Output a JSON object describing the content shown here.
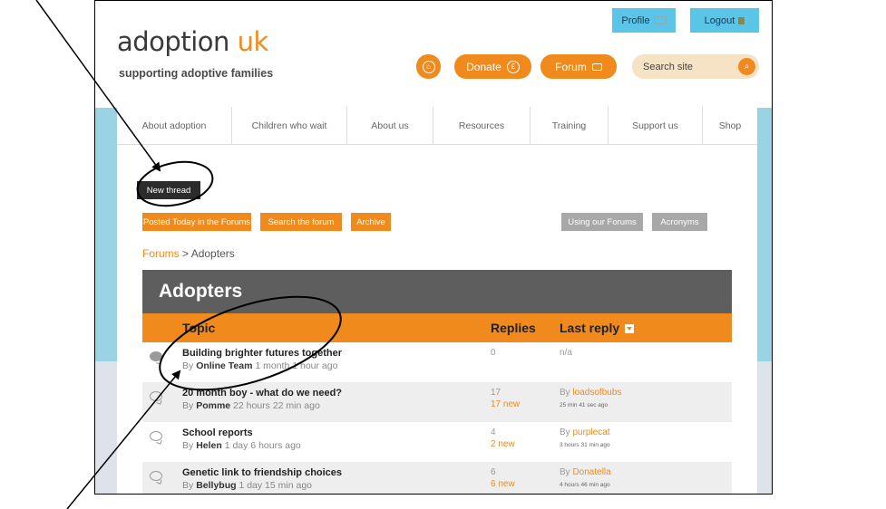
{
  "header": {
    "logo_main": "adoption ",
    "logo_accent": "uk",
    "tagline": "supporting adoptive families",
    "profile_label": "Profile",
    "logout_label": "Logout",
    "donate_label": "Donate",
    "forum_label": "Forum",
    "search_placeholder": "Search site"
  },
  "nav": [
    "About adoption",
    "Children who wait",
    "About us",
    "Resources",
    "Training",
    "Support us",
    "Shop"
  ],
  "toolbar": {
    "new_thread": "New thread",
    "posted_today": "Posted Today in the Forums",
    "search_forum": "Search the forum",
    "archive": "Archive",
    "using_forums": "Using our Forums",
    "acronyms": "Acronyms"
  },
  "breadcrumb": {
    "root": "Forums",
    "sep": ">",
    "current": "Adopters"
  },
  "forum": {
    "title": "Adopters",
    "columns": {
      "topic": "Topic",
      "replies": "Replies",
      "last_reply": "Last reply"
    },
    "rows": [
      {
        "title": "Building brighter futures together",
        "by": "By",
        "author": "Online Team",
        "age": "1 month 1 hour ago",
        "replies": "0",
        "new": "",
        "lr_by": "n/a",
        "lr_user": "",
        "lr_time": "",
        "hot": true,
        "alt": false
      },
      {
        "title": "20 month boy - what do we need?",
        "by": "By",
        "author": "Pomme",
        "age": "22 hours 22 min ago",
        "replies": "17",
        "new": "17 new",
        "lr_by": "By",
        "lr_user": "loadsofbubs",
        "lr_time": "25 min 41 sec ago",
        "hot": false,
        "alt": true
      },
      {
        "title": "School reports",
        "by": "By",
        "author": "Helen",
        "age": "1 day 6 hours ago",
        "replies": "4",
        "new": "2 new",
        "lr_by": "By",
        "lr_user": "purplecat",
        "lr_time": "3 hours 31 min ago",
        "hot": false,
        "alt": false
      },
      {
        "title": "Genetic link to friendship choices",
        "by": "By",
        "author": "Bellybug",
        "age": "1 day 15 min ago",
        "replies": "6",
        "new": "6 new",
        "lr_by": "By",
        "lr_user": "Donatella",
        "lr_time": "4 hours 46 min ago",
        "hot": false,
        "alt": true
      }
    ]
  },
  "colors": {
    "orange": "#f08a1d",
    "dark_bar": "#5e5e5e",
    "sky": "#9ad3e4",
    "top_btn": "#5bc5e8"
  }
}
